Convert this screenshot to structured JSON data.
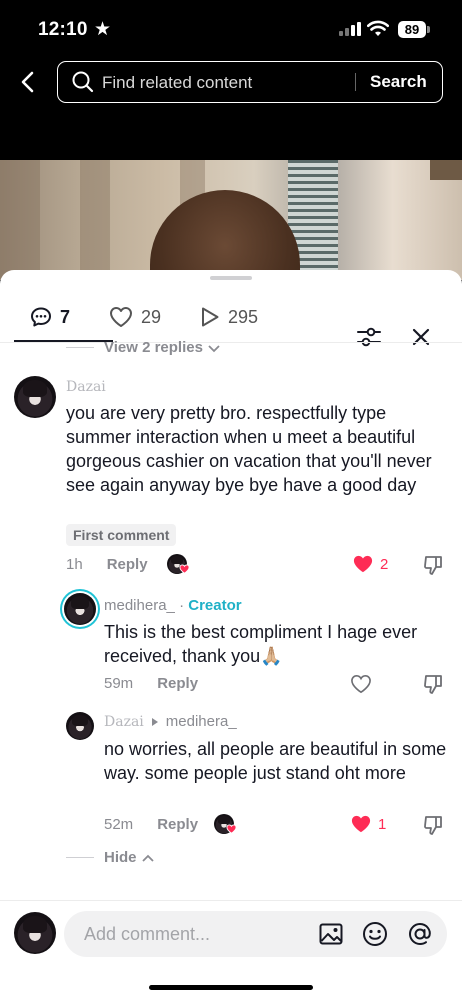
{
  "status_bar": {
    "time": "12:10",
    "battery": "89"
  },
  "search": {
    "placeholder": "Find related content",
    "button": "Search"
  },
  "tabs": {
    "comments": "7",
    "likes": "29",
    "views": "295"
  },
  "view_replies": "View 2 replies",
  "comments": [
    {
      "username": "Dazai",
      "text": "you are very pretty bro. respectfully type summer interaction when u meet a beautiful gorgeous cashier on vacation that you'll never see again anyway bye bye have a good day",
      "badge": "First comment",
      "time": "1h",
      "reply_label": "Reply",
      "likes": "2"
    },
    {
      "username": "medihera_",
      "creator_label": "Creator",
      "text": "This is the best compliment I hage ever received, thank you🙏🏼",
      "time": "59m",
      "reply_label": "Reply"
    },
    {
      "username": "Dazai",
      "reply_to": "medihera_",
      "text": "no worries, all people are beautiful in some way. some people just stand oht more",
      "time": "52m",
      "reply_label": "Reply",
      "likes": "1"
    }
  ],
  "hide_label": "Hide",
  "composer": {
    "placeholder": "Add comment..."
  },
  "colors": {
    "accent_like": "#fe2c55",
    "creator": "#20b1c7"
  }
}
